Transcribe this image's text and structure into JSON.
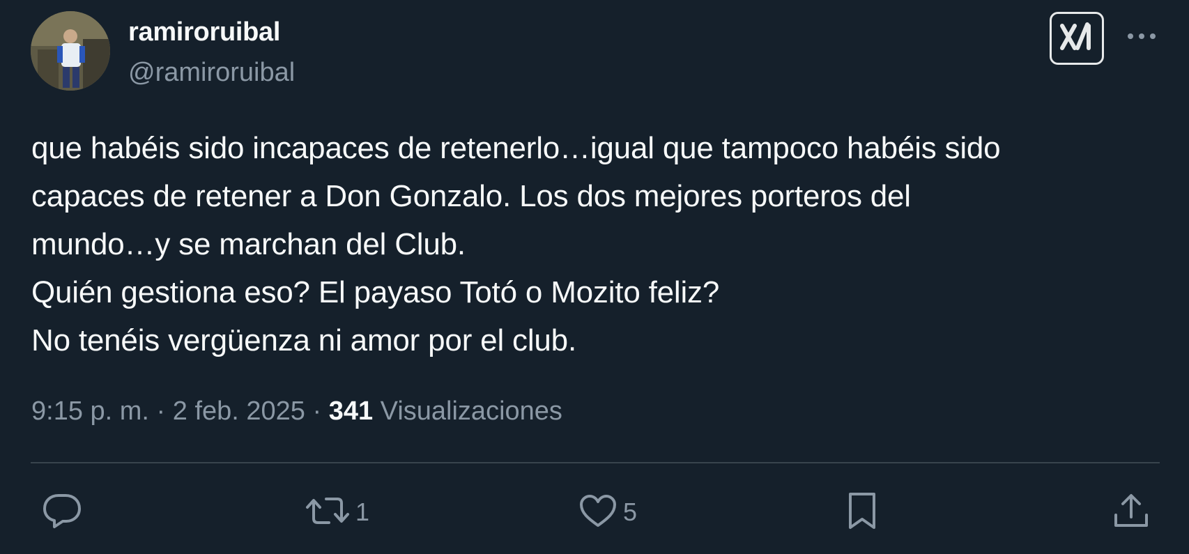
{
  "author": {
    "display_name": "ramiroruibal",
    "handle": "@ramiroruibal"
  },
  "header_icons": {
    "grok": "grok-icon",
    "more": "more-dots-icon"
  },
  "text_lines": [
    "que habéis sido incapaces de retenerlo…igual que tampoco habéis sido",
    "capaces de retener a Don Gonzalo. Los dos mejores porteros del",
    "mundo…y se marchan del Club.",
    "Quién gestiona eso? El payaso Totó o Mozito feliz?",
    "No tenéis vergüenza ni amor por el club."
  ],
  "meta": {
    "time": "9:15 p. m.",
    "sep1": " · ",
    "date": "2 feb. 2025",
    "sep2": " · ",
    "views_count": "341",
    "views_label": " Visualizaciones"
  },
  "actions": {
    "reply": {
      "icon": "reply-icon",
      "count": ""
    },
    "retweet": {
      "icon": "retweet-icon",
      "count": "1"
    },
    "like": {
      "icon": "heart-icon",
      "count": "5"
    },
    "bookmark": {
      "icon": "bookmark-icon",
      "count": ""
    },
    "share": {
      "icon": "share-icon",
      "count": ""
    }
  },
  "colors": {
    "background": "#15202b",
    "text": "#f7f9f9",
    "secondary": "#8b98a5",
    "divider": "#38444d"
  }
}
